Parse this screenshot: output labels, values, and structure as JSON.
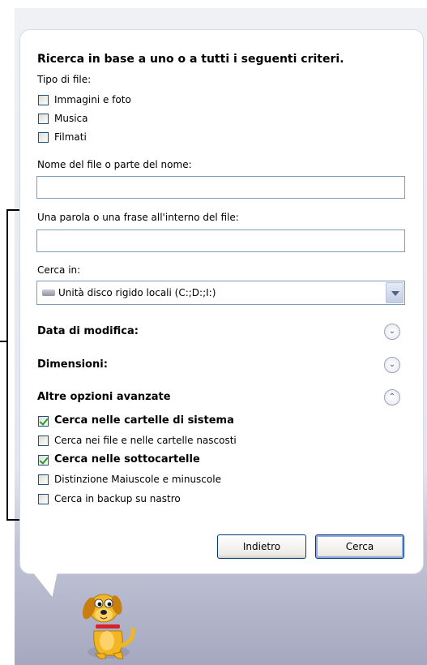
{
  "title": "Ricerca in base a uno o a tutti i seguenti criteri.",
  "file_type_label": "Tipo di file:",
  "file_types": [
    {
      "label": "Immagini e foto",
      "checked": false
    },
    {
      "label": "Musica",
      "checked": false
    },
    {
      "label": "Filmati",
      "checked": false
    }
  ],
  "name_label": "Nome del file o parte del nome:",
  "name_value": "",
  "phrase_label": "Una parola o una frase all'interno del file:",
  "phrase_value": "",
  "search_in_label": "Cerca in:",
  "search_in_value": "Unità disco rigido locali (C:;D:;I:)",
  "sections": {
    "date": "Data di modifica:",
    "size": "Dimensioni:",
    "advanced": "Altre opzioni avanzate"
  },
  "advanced_options": [
    {
      "label": "Cerca nelle cartelle di sistema",
      "checked": true
    },
    {
      "label": "Cerca nei file e nelle cartelle nascosti",
      "checked": false
    },
    {
      "label": "Cerca nelle sottocartelle",
      "checked": true
    },
    {
      "label": "Distinzione Maiuscole e minuscole",
      "checked": false
    },
    {
      "label": "Cerca in backup su nastro",
      "checked": false
    }
  ],
  "buttons": {
    "back": "Indietro",
    "search": "Cerca"
  },
  "icons": {
    "drive": "hard-drive-icon",
    "expand": "chevron-double-down-icon",
    "collapse": "chevron-double-up-icon",
    "assistant": "search-dog-icon"
  }
}
